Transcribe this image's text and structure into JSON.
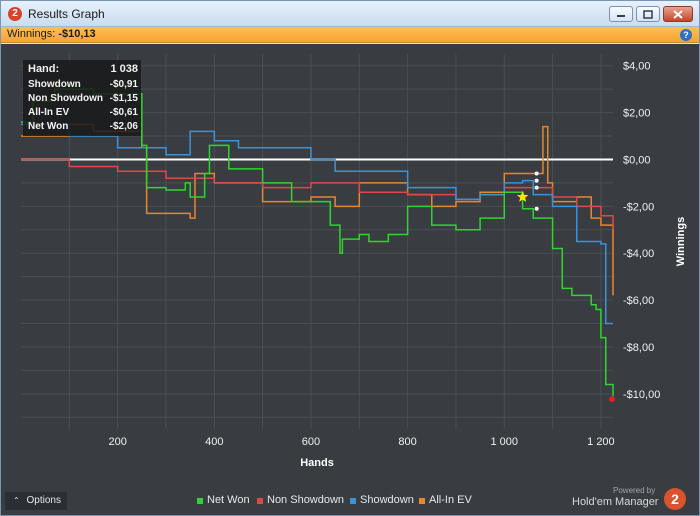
{
  "window": {
    "title": "Results Graph",
    "app_icon": "2",
    "controls": [
      "minimize-icon",
      "maximize-icon",
      "close-icon"
    ]
  },
  "winnings_bar": {
    "label": "Winnings:",
    "value": "-$10,13",
    "help_icon": "?"
  },
  "tooltip": {
    "rows": [
      {
        "label": "Hand:",
        "value": "1 038"
      },
      {
        "label": "Showdown",
        "value": "-$0,91"
      },
      {
        "label": "Non Showdown",
        "value": "-$1,15"
      },
      {
        "label": "All-In EV",
        "value": "-$0,61"
      },
      {
        "label": "Net Won",
        "value": "-$2,06"
      }
    ]
  },
  "options_button": {
    "label": "Options",
    "icon": "chevron-up-icon"
  },
  "footer": {
    "powered_by": "Powered by",
    "brand": "Hold'em Manager",
    "brand_logo": "2"
  },
  "colors": {
    "net_won": "#2fd42f",
    "non_showdown": "#e04848",
    "showdown": "#3a93d8",
    "allin_ev": "#e8862a",
    "background": "#393d42",
    "grid": "#4a4f55",
    "zero_line": "#ffffff",
    "winnings_bar": "#f4a433",
    "marker_star": "#ffe600"
  },
  "chart_data": {
    "type": "line",
    "xlabel": "Hands",
    "ylabel": "Winnings",
    "x_ticks": [
      "200",
      "400",
      "600",
      "800",
      "1 000",
      "1 200"
    ],
    "y_ticks": [
      "$4,00",
      "$2,00",
      "$0,00",
      "-$2,00",
      "-$4,00",
      "-$6,00",
      "-$8,00",
      "-$10,00"
    ],
    "xlim": [
      0,
      1225
    ],
    "ylim": [
      -11.5,
      4.5
    ],
    "grid": true,
    "legend_position": "bottom-center",
    "highlight_hand": 1038,
    "series": [
      {
        "name": "Net Won",
        "x": [
          0,
          25,
          70,
          110,
          150,
          250,
          260,
          300,
          340,
          350,
          380,
          390,
          400,
          430,
          500,
          560,
          600,
          640,
          660,
          665,
          680,
          700,
          720,
          760,
          800,
          850,
          900,
          950,
          1000,
          1038,
          1060,
          1100,
          1120,
          1140,
          1180,
          1190,
          1200,
          1210,
          1225
        ],
        "y": [
          1.6,
          2.5,
          3.0,
          3.0,
          2.8,
          0.6,
          -1.2,
          -1.3,
          -1.0,
          -1.6,
          -0.6,
          0.6,
          0.6,
          -0.4,
          -1.0,
          -1.8,
          -1.8,
          -2.8,
          -4.0,
          -3.4,
          -3.4,
          -3.2,
          -3.5,
          -3.2,
          -2.0,
          -2.8,
          -3.0,
          -2.5,
          -1.4,
          -2.1,
          -2.5,
          -3.8,
          -5.5,
          -5.8,
          -6.2,
          -6.4,
          -7.6,
          -9.6,
          -10.1
        ]
      },
      {
        "name": "Non Showdown",
        "x": [
          0,
          100,
          200,
          300,
          400,
          500,
          600,
          700,
          800,
          900,
          950,
          1000,
          1038,
          1100,
          1150,
          1200,
          1225
        ],
        "y": [
          0.0,
          -0.3,
          -0.5,
          -0.8,
          -1.0,
          -1.2,
          -1.0,
          -1.4,
          -1.5,
          -1.7,
          -1.5,
          -1.2,
          -1.2,
          -1.6,
          -2.0,
          -2.4,
          -3.0
        ]
      },
      {
        "name": "Showdown",
        "x": [
          0,
          100,
          200,
          300,
          350,
          360,
          400,
          450,
          500,
          600,
          650,
          700,
          800,
          900,
          950,
          1000,
          1038,
          1060,
          1100,
          1150,
          1200,
          1210,
          1225
        ],
        "y": [
          1.5,
          1.0,
          0.5,
          0.2,
          1.2,
          1.2,
          0.8,
          0.5,
          0.5,
          0.0,
          -0.5,
          -0.5,
          -1.2,
          -1.7,
          -1.5,
          -1.0,
          -0.9,
          -1.5,
          -2.0,
          -3.5,
          -3.6,
          -7.0,
          -7.0
        ]
      },
      {
        "name": "All-In EV",
        "x": [
          0,
          100,
          150,
          250,
          260,
          350,
          360,
          400,
          500,
          600,
          650,
          700,
          750,
          800,
          850,
          900,
          950,
          1000,
          1038,
          1060,
          1080,
          1090,
          1100,
          1150,
          1180,
          1200,
          1225
        ],
        "y": [
          1.0,
          1.5,
          1.2,
          0.5,
          -2.3,
          -2.5,
          -0.6,
          -1.0,
          -1.8,
          -1.6,
          -2.0,
          -1.0,
          -1.0,
          -1.5,
          -2.0,
          -1.8,
          -1.4,
          -0.6,
          -0.6,
          -0.6,
          1.4,
          -1.0,
          -1.8,
          -1.6,
          -2.5,
          -2.8,
          -5.8
        ]
      }
    ]
  }
}
